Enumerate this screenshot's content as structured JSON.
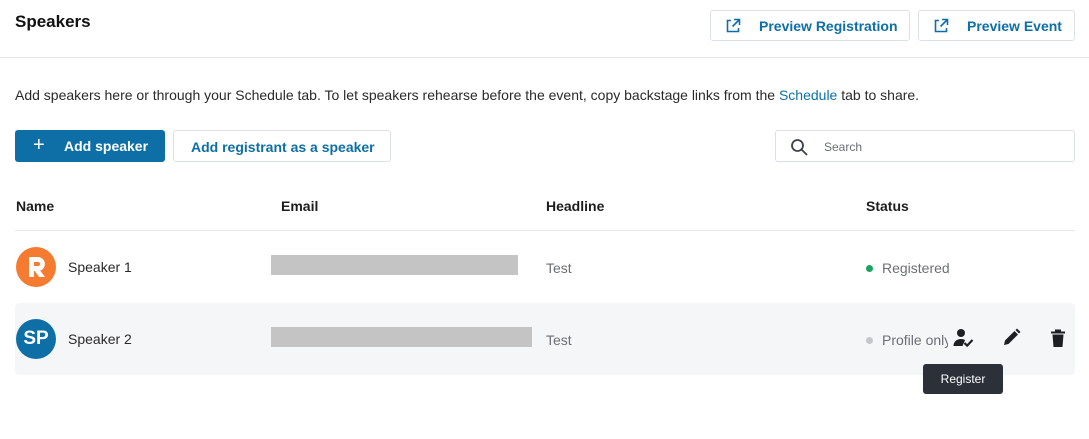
{
  "header": {
    "title": "Speakers",
    "preview_registration": "Preview Registration",
    "preview_event": "Preview Event"
  },
  "intro": {
    "text_before": "Add speakers here or through your Schedule tab. To let speakers rehearse before the event, copy backstage links from the ",
    "link": "Schedule",
    "text_after": " tab to share."
  },
  "toolbar": {
    "add_speaker": "Add speaker",
    "add_registrant": "Add registrant as a speaker",
    "search_placeholder": "Search"
  },
  "table": {
    "columns": [
      "Name",
      "Email",
      "Headline",
      "Status"
    ],
    "rows": [
      {
        "name": "Speaker 1",
        "avatar_text": "",
        "avatar_color": "#f47b30",
        "email": "",
        "headline": "Test",
        "status": "Registered",
        "status_color": "#1aa260"
      },
      {
        "name": "Speaker 2",
        "avatar_text": "SP",
        "avatar_color": "#0e6fa6",
        "email": "",
        "headline": "Test",
        "status": "Profile only",
        "status_color": "#c4c6c9"
      }
    ]
  },
  "tooltip": {
    "text": "Register"
  },
  "colors": {
    "accent": "#0e6fa6",
    "registered": "#1aa260",
    "profile_only": "#c4c6c9",
    "tooltip_bg": "#2b3039"
  },
  "icons": [
    "external-link-icon",
    "plus-icon",
    "search-icon",
    "register-user-icon",
    "pencil-icon",
    "trash-icon",
    "logo-icon"
  ]
}
